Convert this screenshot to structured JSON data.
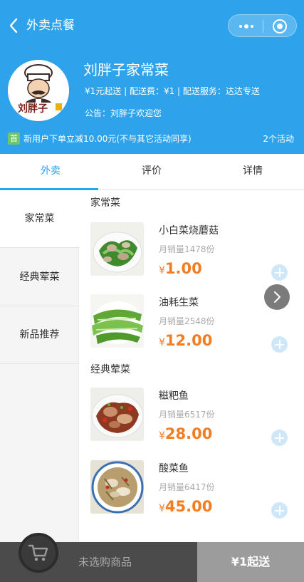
{
  "nav": {
    "title": "外卖点餐"
  },
  "shop": {
    "name": "刘胖子家常菜",
    "info": "¥1元起送 | 配送费：¥1 | 配送服务：达达专送",
    "notice": "公告：刘胖子欢迎您",
    "logo_text": "刘胖子"
  },
  "promo": {
    "badge": "首",
    "text": "新用户下单立减10.00元(不与其它活动同享)",
    "count": "2个活动"
  },
  "tabs": [
    {
      "label": "外卖",
      "active": true
    },
    {
      "label": "评价",
      "active": false
    },
    {
      "label": "详情",
      "active": false
    }
  ],
  "categories": [
    {
      "label": "家常菜",
      "active": true
    },
    {
      "label": "经典荤菜",
      "active": false
    },
    {
      "label": "新品推荐",
      "active": false
    }
  ],
  "sections": [
    {
      "title": "家常菜",
      "dishes": [
        {
          "name": "小白菜烧蘑菇",
          "sales": "月销量1478份",
          "currency": "¥",
          "price": "1.00"
        },
        {
          "name": "油耗生菜",
          "sales": "月销量2548份",
          "currency": "¥",
          "price": "12.00"
        }
      ]
    },
    {
      "title": "经典荤菜",
      "dishes": [
        {
          "name": "糍粑鱼",
          "sales": "月销量6517份",
          "currency": "¥",
          "price": "28.00"
        },
        {
          "name": "酸菜鱼",
          "sales": "月销量6417份",
          "currency": "¥",
          "price": "45.00"
        }
      ]
    }
  ],
  "cart": {
    "empty_text": "未选购商品",
    "min_order": "¥1起送"
  },
  "colors": {
    "brand": "#2ea3ec",
    "price": "#f57c1f",
    "promo_badge": "#71c56a"
  }
}
